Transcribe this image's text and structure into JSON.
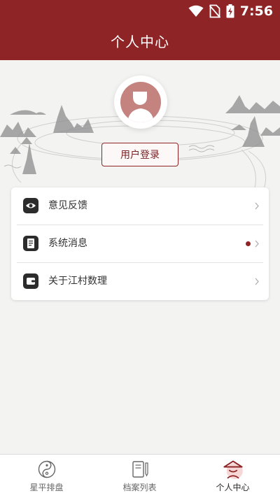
{
  "status_bar": {
    "time": "7:56",
    "icons": [
      "wifi-icon",
      "no-sim-icon",
      "battery-charging-icon"
    ]
  },
  "header": {
    "title": "个人中心"
  },
  "profile": {
    "avatar": "default-user-avatar",
    "login_label": "用户登录"
  },
  "menu": {
    "items": [
      {
        "label": "意见反馈",
        "icon": "eye-icon",
        "badge": false
      },
      {
        "label": "系统消息",
        "icon": "document-icon",
        "badge": true
      },
      {
        "label": "关于江村数理",
        "icon": "wallet-icon",
        "badge": false
      }
    ]
  },
  "tabbar": {
    "tabs": [
      {
        "label": "星平排盘",
        "icon": "yin-yang-icon",
        "active": false
      },
      {
        "label": "档案列表",
        "icon": "notebook-pen-icon",
        "active": false
      },
      {
        "label": "个人中心",
        "icon": "hat-person-icon",
        "active": true
      }
    ]
  },
  "colors": {
    "brand": "#8e2426",
    "badge": "#8e2426",
    "background": "#f3f3f2"
  }
}
